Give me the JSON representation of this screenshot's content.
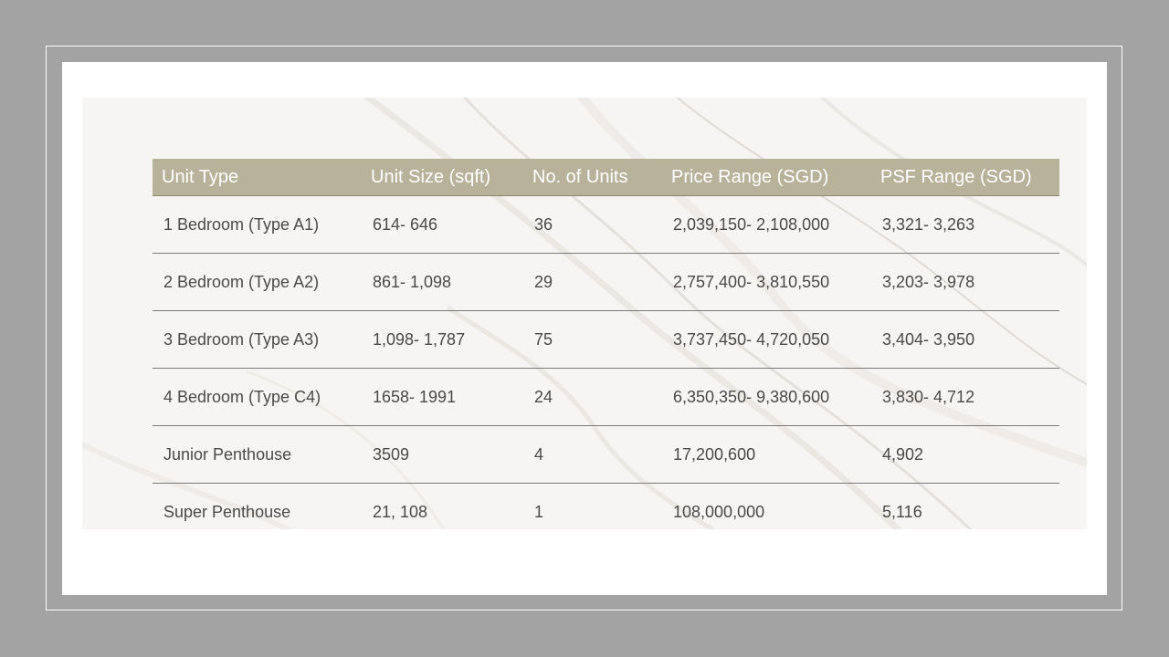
{
  "table": {
    "headers": [
      "Unit Type",
      "Unit Size (sqft)",
      "No. of Units",
      "Price Range (SGD)",
      "PSF Range (SGD)"
    ],
    "rows": [
      [
        "1 Bedroom (Type A1)",
        "614- 646",
        "36",
        "2,039,150- 2,108,000",
        "3,321- 3,263"
      ],
      [
        "2 Bedroom (Type A2)",
        "861- 1,098",
        "29",
        "2,757,400- 3,810,550",
        "3,203- 3,978"
      ],
      [
        "3 Bedroom (Type A3)",
        "1,098- 1,787",
        "75",
        "3,737,450- 4,720,050",
        "3,404- 3,950"
      ],
      [
        "4 Bedroom (Type C4)",
        "1658- 1991",
        "24",
        "6,350,350- 9,380,600",
        "3,830- 4,712"
      ],
      [
        "Junior Penthouse",
        "3509",
        "4",
        "17,200,600",
        "4,902"
      ],
      [
        "Super Penthouse",
        "21, 108",
        "1",
        "108,000,000",
        "5,116"
      ]
    ]
  },
  "colors": {
    "background": "#a3a3a3",
    "slide": "#ffffff",
    "header_fill": "#b8b29b",
    "row_divider": "#7a7a7a"
  }
}
